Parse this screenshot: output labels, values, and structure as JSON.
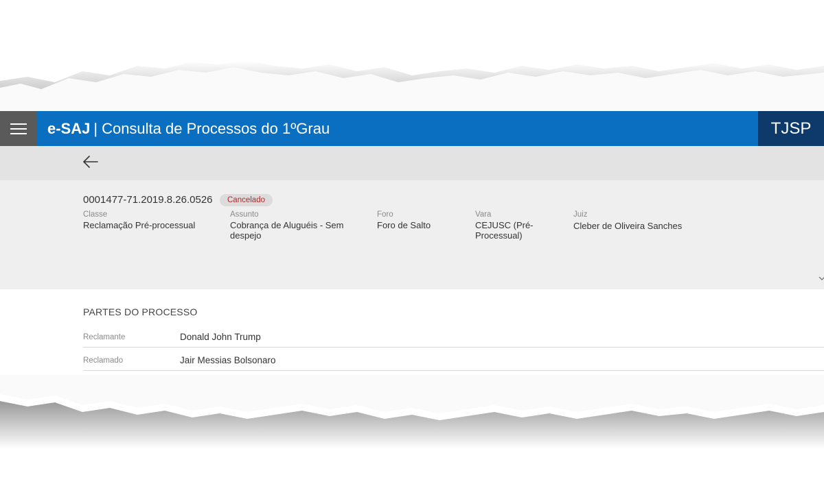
{
  "header": {
    "menu_icon": "hamburger-menu-icon",
    "brand": "e-SAJ",
    "separator": "|",
    "title": "Consulta de Processos do 1ºGrau",
    "court": "TJSP",
    "colors": {
      "bar": "#0b6fc1",
      "court_bg": "#0d3a6b",
      "menu_bg": "#5a5a5a"
    }
  },
  "nav": {
    "back_icon": "arrow-left-icon"
  },
  "process": {
    "number": "0001477-71.2019.8.26.0526",
    "status": "Cancelado",
    "status_color": "#b02a2a",
    "fields": [
      {
        "label": "Classe",
        "value": "Reclamação Pré-processual"
      },
      {
        "label": "Assunto",
        "value": "Cobrança de Aluguéis - Sem despejo"
      },
      {
        "label": "Foro",
        "value": "Foro de Salto"
      },
      {
        "label": "Vara",
        "value": "CEJUSC (Pré-Processual)"
      },
      {
        "label": "Juiz",
        "value": "Cleber de Oliveira Sanches"
      }
    ],
    "expand_icon": "chevron-down-icon"
  },
  "parties": {
    "title": "PARTES DO PROCESSO",
    "rows": [
      {
        "role": "Reclamante",
        "name": "Donald John Trump"
      },
      {
        "role": "Reclamado",
        "name": "Jair Messias Bolsonaro"
      }
    ]
  }
}
